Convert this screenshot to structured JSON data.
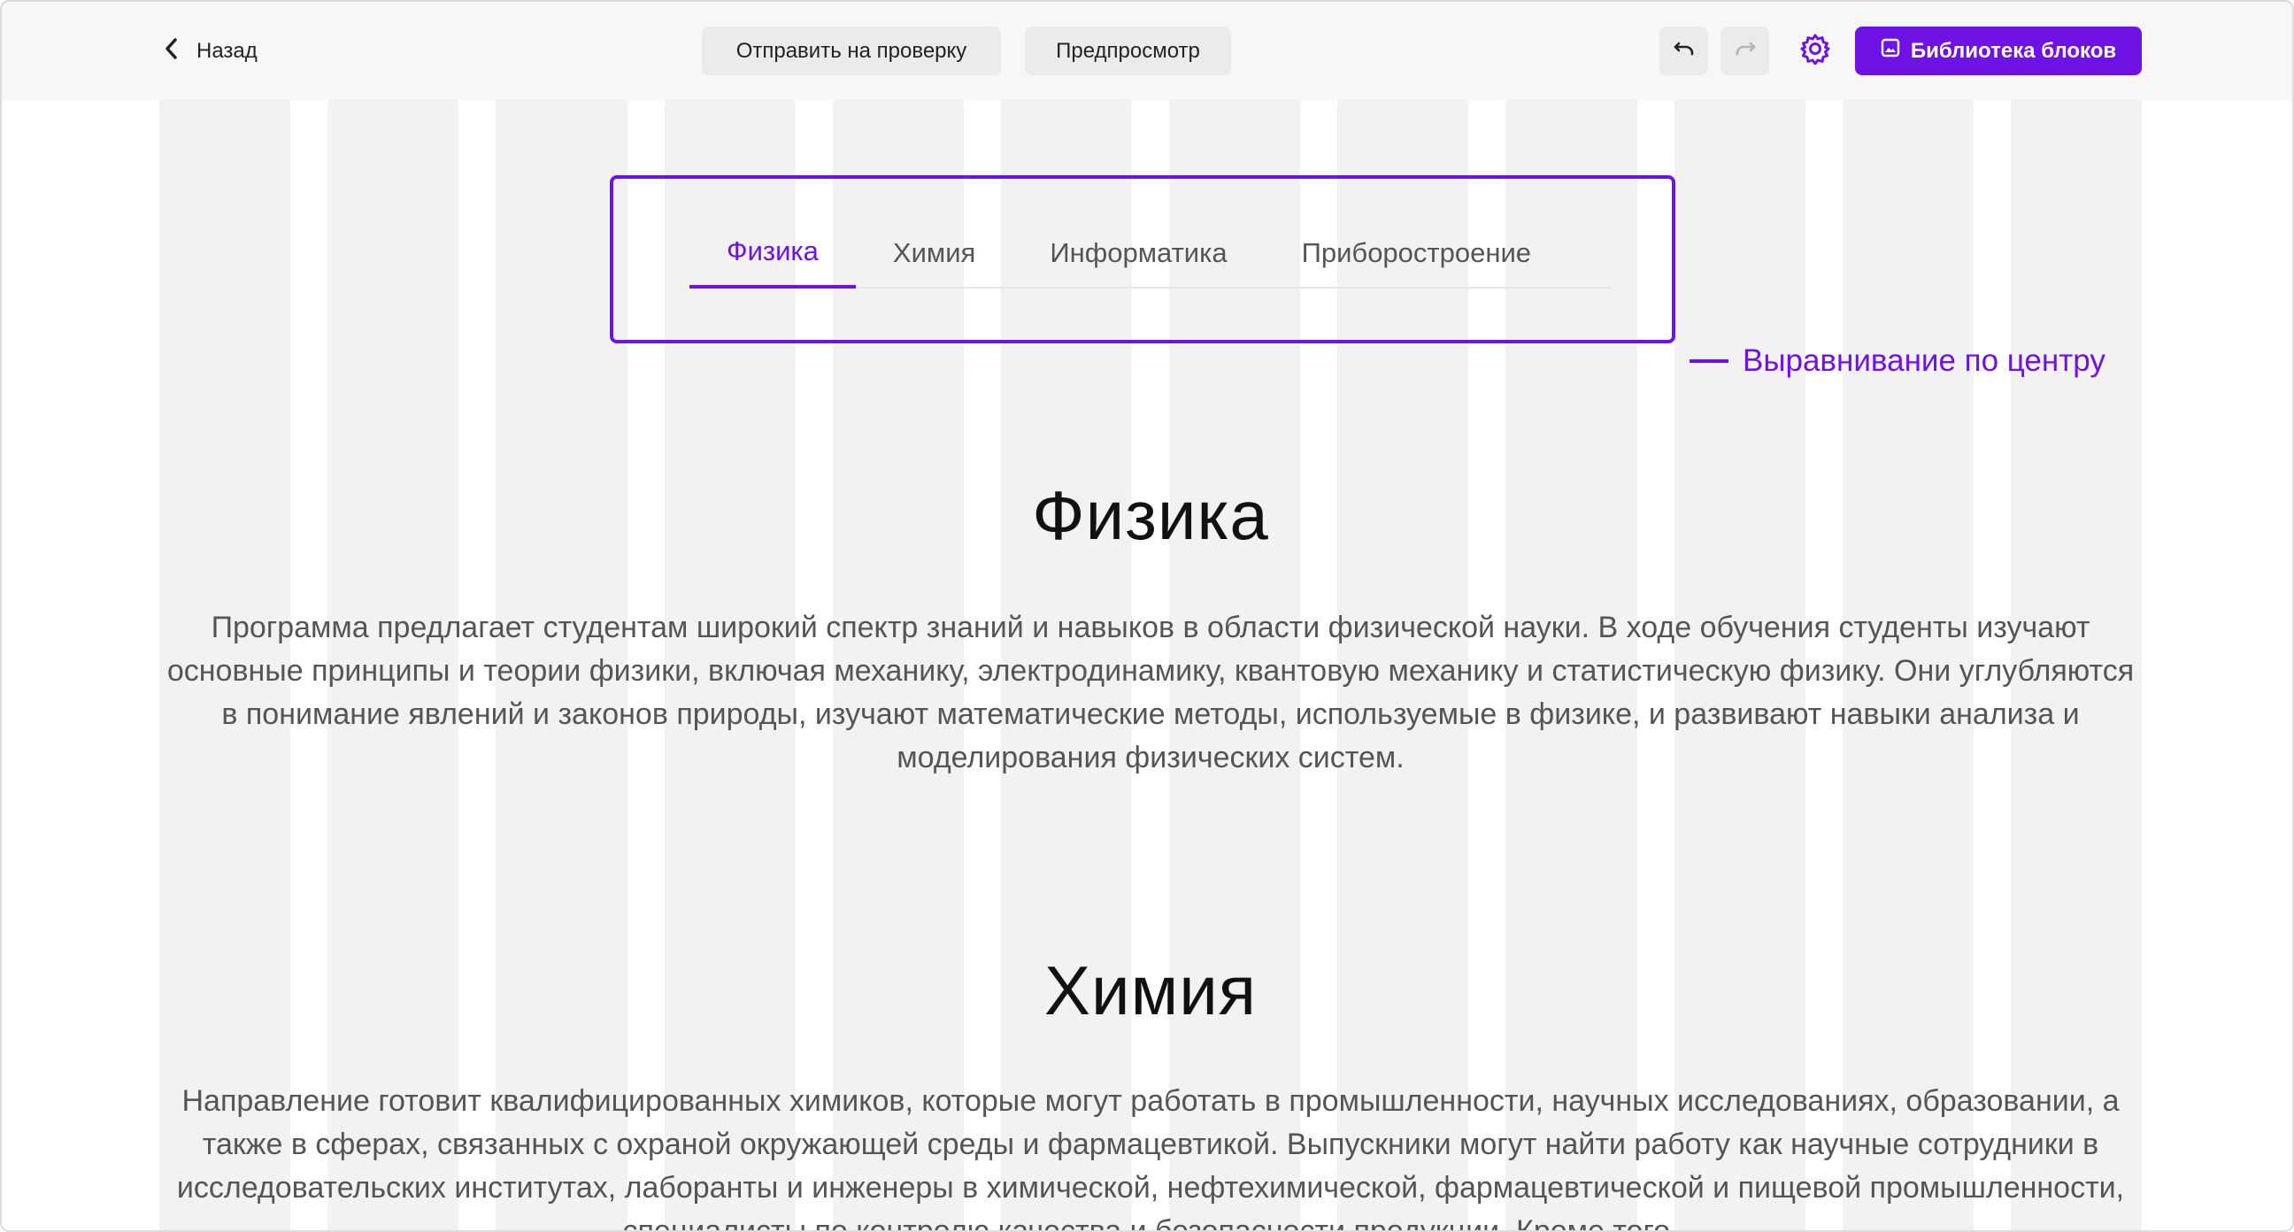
{
  "toolbar": {
    "back_label": "Назад",
    "submit_label": "Отправить на проверку",
    "preview_label": "Предпросмотр",
    "library_label": "Библиотека блоков"
  },
  "tabs": [
    {
      "label": "Физика",
      "active": true
    },
    {
      "label": "Химия",
      "active": false
    },
    {
      "label": "Информатика",
      "active": false
    },
    {
      "label": "Приборостроение",
      "active": false
    }
  ],
  "annotation": "Выравнивание по центру",
  "sections": [
    {
      "title": "Физика",
      "text": "Программа предлагает студентам широкий спектр знаний и навыков в области физической науки. В ходе обучения студенты изучают основные принципы и теории физики, включая механику, электродинамику, квантовую механику и статистическую физику. Они углубляются в понимание явлений и законов природы, изучают математические методы, используемые в физике, и развивают навыки анализа и моделирования физических систем."
    },
    {
      "title": "Химия",
      "text": "Направление готовит квалифицированных химиков, которые могут работать в промышленности, научных исследованиях, образовании, а также в сферах, связанных с охраной окружающей среды и фармацевтикой. Выпускники могут найти работу как научные сотрудники в исследовательских институтах, лаборанты и инженеры в химической, нефтехимической, фармацевтической и пищевой промышленности, специалисты по контролю качества и безопасности продукции. Кроме того,"
    }
  ],
  "colors": {
    "accent": "#6e12e6",
    "toolbar_bg": "#f7f7f7",
    "grid_column": "#f2f2f2"
  }
}
